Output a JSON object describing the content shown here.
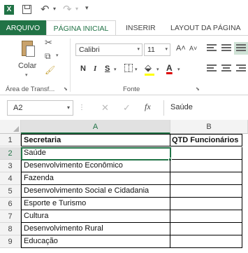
{
  "quick_access": {
    "app_icon": "excel-icon",
    "icons": [
      "save-icon",
      "undo-icon",
      "redo-icon",
      "customize-icon"
    ]
  },
  "tabs": [
    {
      "label": "ARQUIVO"
    },
    {
      "label": "PÁGINA INICIAL"
    },
    {
      "label": "INSERIR"
    },
    {
      "label": "LAYOUT DA PÁGINA"
    }
  ],
  "ribbon": {
    "paste_label": "Colar",
    "clipboard_group": "Área de Transf...",
    "font_group": "Fonte",
    "font_name": "Calibri",
    "font_size": "11",
    "bold": "N",
    "italic": "I",
    "underline": "S",
    "grow_font": "A˄",
    "shrink_font": "A˅",
    "font_color": "A",
    "fill_color": "#ffff00",
    "font_color_value": "#dd0000"
  },
  "formula_bar": {
    "name_box": "A2",
    "fx": "fx",
    "content": "Saúde"
  },
  "columns": [
    {
      "label": "A"
    },
    {
      "label": "B"
    }
  ],
  "rows": [
    {
      "num": "1",
      "a": "Secretaria",
      "b": "QTD Funcionários"
    },
    {
      "num": "2",
      "a": "Saúde",
      "b": ""
    },
    {
      "num": "3",
      "a": "Desenvolvimento Econômico",
      "b": ""
    },
    {
      "num": "4",
      "a": "Fazenda",
      "b": ""
    },
    {
      "num": "5",
      "a": "Desenvolvimento Social e Cidadania",
      "b": ""
    },
    {
      "num": "6",
      "a": "Esporte e Turismo",
      "b": ""
    },
    {
      "num": "7",
      "a": "Cultura",
      "b": ""
    },
    {
      "num": "8",
      "a": "Desenvolvimento Rural",
      "b": ""
    },
    {
      "num": "9",
      "a": "Educação",
      "b": ""
    }
  ],
  "accent_color": "#217346"
}
